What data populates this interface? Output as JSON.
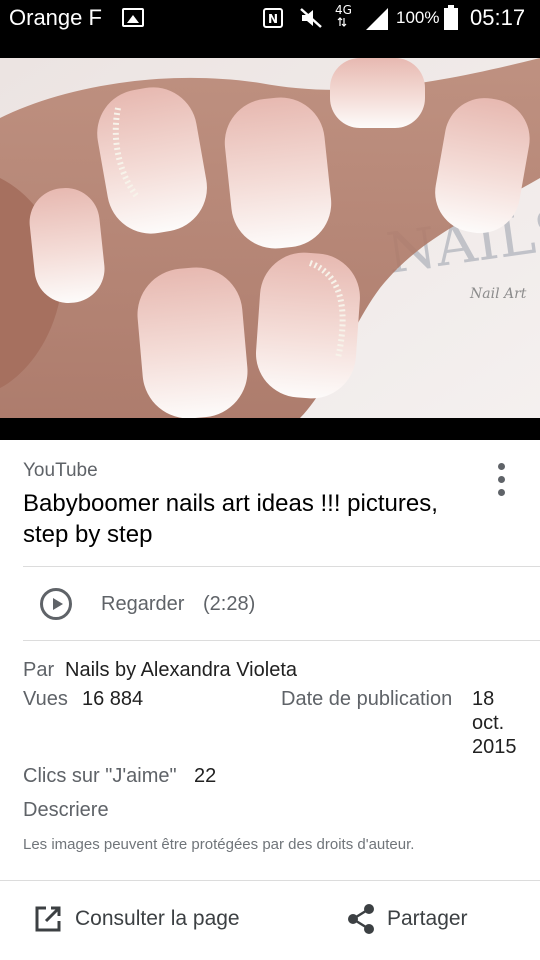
{
  "status_bar": {
    "carrier": "Orange F",
    "network": "4G",
    "battery": "100%",
    "time": "05:17"
  },
  "image": {
    "description_icon": "nail-art-photo"
  },
  "card": {
    "source": "YouTube",
    "title": "Babyboomer nails art ideas !!! pictures, step by step",
    "watch": {
      "label": "Regarder",
      "duration": "(2:28)"
    },
    "author": {
      "key": "Par",
      "value": "Nails by Alexandra Violeta"
    },
    "views": {
      "key": "Vues",
      "value": "16 884"
    },
    "date": {
      "key": "Date de publication",
      "value": "18 oct. 2015"
    },
    "likes": {
      "key": "Clics sur \"J'aime\"",
      "value": "22"
    },
    "describe_label": "Descriere",
    "copyright": "Les images peuvent être protégées par des droits d'auteur.",
    "actions": {
      "visit": "Consulter la page",
      "share": "Partager"
    }
  },
  "colors": {
    "status_bar_bg": "#000000",
    "card_text_secondary": "#5f6368",
    "card_text_primary": "#212121"
  }
}
